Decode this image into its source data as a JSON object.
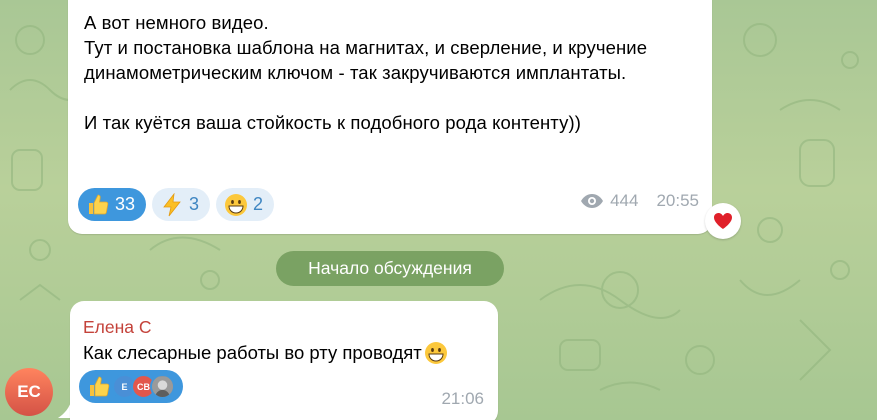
{
  "post": {
    "lines": [
      "А вот немного видео.",
      "Тут и постановка шаблона на магнитах, и сверление, и кручение",
      "динамометрическим ключом - так закручиваются имплантаты.",
      "И так куётся ваша стойкость к подобного рода контенту))"
    ],
    "reactions": [
      {
        "icon": "thumbs-up-icon",
        "count": "33",
        "active": true
      },
      {
        "icon": "lightning-icon",
        "count": "3",
        "active": false
      },
      {
        "icon": "grinning-face-icon",
        "count": "2",
        "active": false
      }
    ],
    "views": "444",
    "time": "20:55",
    "my_reaction_icon": "red-heart-icon"
  },
  "service": {
    "label": "Начало обсуждения"
  },
  "comment": {
    "author": "Елена С",
    "text": "Как слесарные работы во рту проводят",
    "emoji_icon": "grinning-face-icon",
    "reaction_icon": "thumbs-up-icon",
    "reactor_initials": [
      "Е",
      "СВ"
    ],
    "time": "21:06"
  },
  "sender_avatar": {
    "initials": "ЕС"
  },
  "colors": {
    "accent": "#3e97dd",
    "author_name": "#c4423a",
    "avatar_gradient_top": "#ff845e",
    "avatar_gradient_bottom": "#d45246",
    "chat_background": "#b5cd98"
  }
}
